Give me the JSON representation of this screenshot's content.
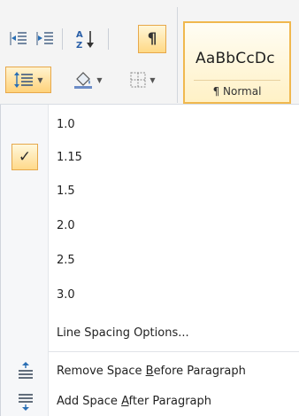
{
  "ribbon": {
    "sort_label": "A Z",
    "pilcrow_label": "¶",
    "style_sample": "AaBbCcDc",
    "style_name": "¶ Normal",
    "accent_color": "#f0b84e"
  },
  "menu": {
    "items": [
      {
        "label": "1.0",
        "checked": false
      },
      {
        "label": "1.15",
        "checked": true
      },
      {
        "label": "1.5",
        "checked": false
      },
      {
        "label": "2.0",
        "checked": false
      },
      {
        "label": "2.5",
        "checked": false
      },
      {
        "label": "3.0",
        "checked": false
      },
      {
        "label": "Line Spacing Options...",
        "checked": false
      }
    ],
    "checkmark": "✓",
    "remove_space": {
      "pre": "Remove Space ",
      "key": "B",
      "post": "efore Paragraph"
    },
    "add_space": {
      "pre": "Add Space ",
      "key": "A",
      "post": "fter Paragraph"
    }
  }
}
